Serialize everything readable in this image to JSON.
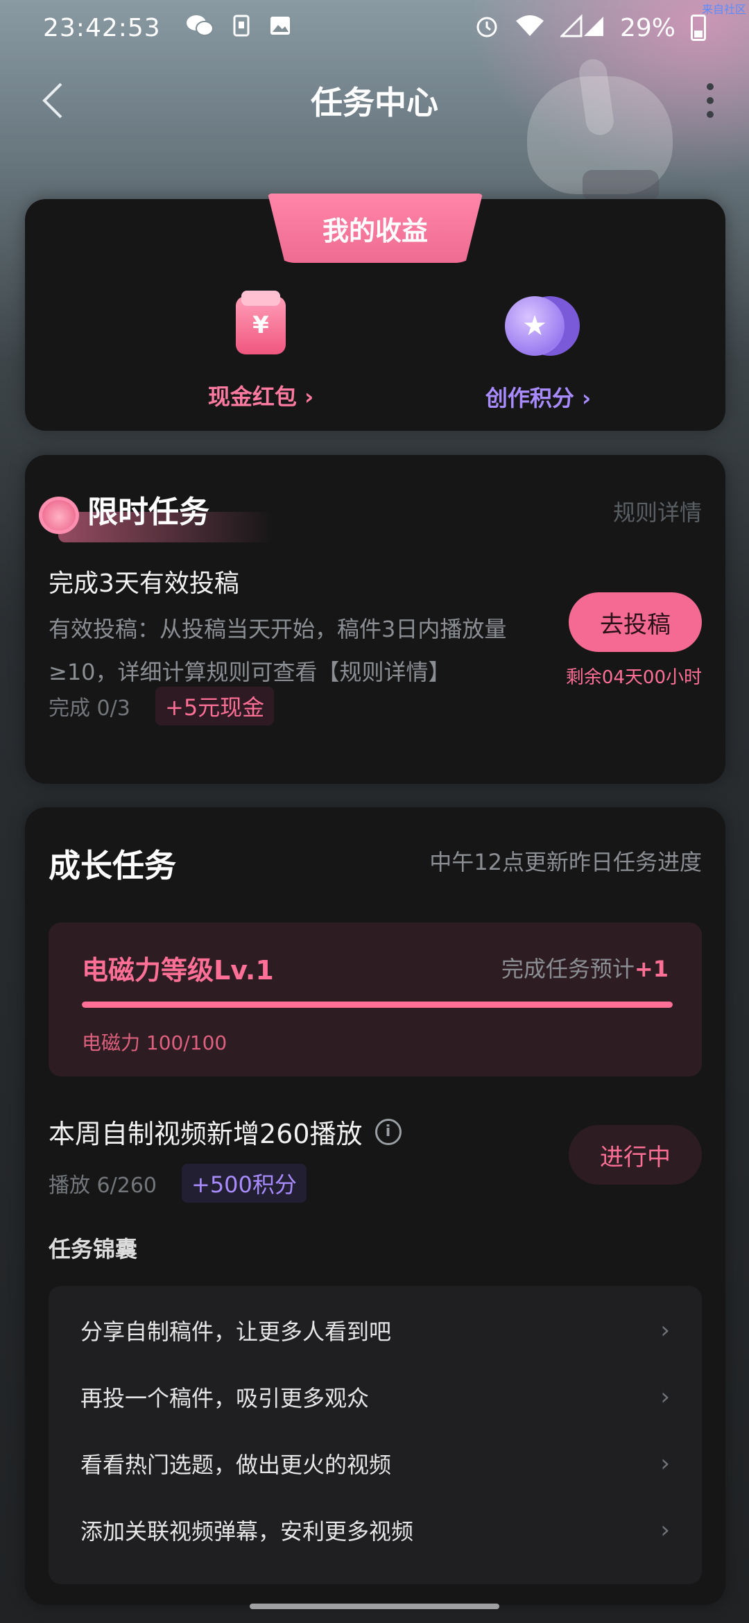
{
  "status_bar": {
    "time": "23:42:53",
    "battery": "29%",
    "icons_left": [
      "wechat-icon",
      "sim-card-icon",
      "gallery-icon"
    ],
    "icons_right": [
      "alarm-icon",
      "wifi-icon",
      "signal-icon",
      "battery-icon"
    ],
    "corner_mark": "来自社区"
  },
  "nav": {
    "title": "任务中心",
    "back_icon": "chevron-left-icon",
    "more_icon": "more-vertical-icon"
  },
  "earnings": {
    "tab_label": "我的收益",
    "cash_label": "现金红包 ›",
    "points_label": "创作积分 ›",
    "cash_icon_glyph": "¥",
    "points_icon_glyph": "★"
  },
  "limited_task": {
    "title": "限时任务",
    "rules_link": "规则详情",
    "task_name": "完成3天有效投稿",
    "task_desc": "有效投稿：从投稿当天开始，稿件3日内播放量≥10，详细计算规则可查看【规则详情】",
    "progress": "完成 0/3",
    "reward": "+5元现金",
    "button_label": "去投稿",
    "remaining": "剩余04天00小时"
  },
  "growth": {
    "title": "成长任务",
    "update_note": "中午12点更新昨日任务进度",
    "level": {
      "name": "电磁力等级Lv.1",
      "expect_prefix": "完成任务预计",
      "expect_value": "+1",
      "value_text": "电磁力 100/100",
      "progress_fraction": 1.0
    },
    "weekly": {
      "name": "本周自制视频新增260播放",
      "info_glyph": "i",
      "progress": "播放 6/260",
      "reward": "+500积分",
      "button_label": "进行中"
    },
    "tips_title": "任务锦囊",
    "tips": [
      {
        "text": "分享自制稿件，让更多人看到吧"
      },
      {
        "text": "再投一个稿件，吸引更多观众"
      },
      {
        "text": "看看热门选题，做出更火的视频"
      },
      {
        "text": "添加关联视频弹幕，安利更多视频"
      }
    ]
  },
  "colors": {
    "accent_pink": "#ff6f96",
    "accent_purple": "#a88cff",
    "card_bg": "#161617"
  }
}
